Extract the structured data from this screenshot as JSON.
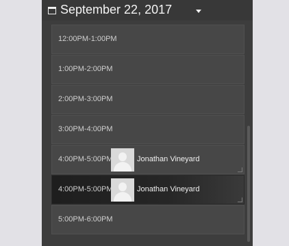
{
  "header": {
    "date": "September 22, 2017",
    "icon": "calendar-icon",
    "dropdown_icon": "chevron-down-icon"
  },
  "slots": [
    {
      "time": "12:00PM-1:00PM"
    },
    {
      "time": "1:00PM-2:00PM"
    },
    {
      "time": "2:00PM-3:00PM"
    },
    {
      "time": "3:00PM-4:00PM"
    },
    {
      "time": "4:00PM-5:00PM",
      "attendee": "Jonathan Vineyard",
      "avatar_icon": "user-avatar-icon"
    },
    {
      "time": "4:00PM-5:00PM",
      "attendee": "Jonathan Vineyard",
      "avatar_icon": "user-avatar-icon",
      "selected": true
    },
    {
      "time": "5:00PM-6:00PM"
    }
  ],
  "colors": {
    "background": "#e2e1e6",
    "panel": "#3d3d3d",
    "slot": "#474747",
    "selected_slot": "#1e1e1e",
    "text": "#f0f0f0"
  }
}
